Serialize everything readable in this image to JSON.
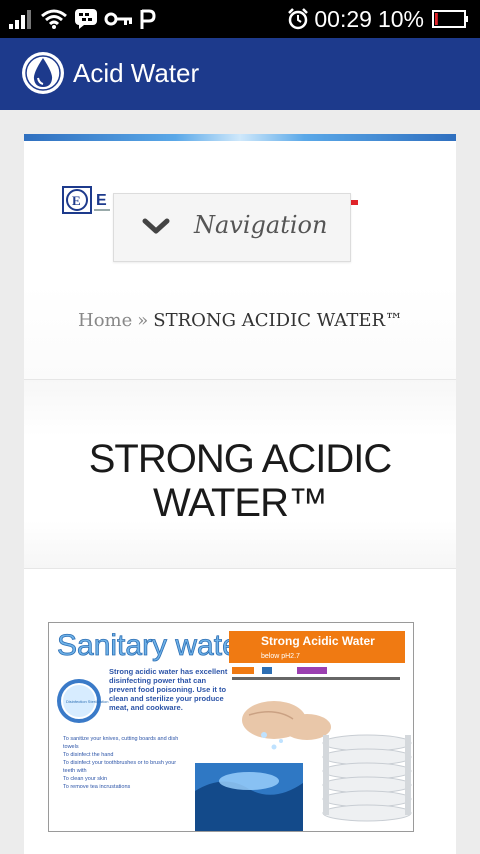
{
  "status_bar": {
    "time": "00:29",
    "battery_percent": "10%",
    "battery_level": 0.1,
    "icons": [
      "signal-icon",
      "wifi-icon",
      "bbm-icon",
      "key-icon",
      "p-icon",
      "alarm-icon",
      "battery-icon"
    ]
  },
  "app_bar": {
    "title": "Acid Water",
    "logo_icon": "water-drop-icon",
    "color": "#1d3a8c"
  },
  "navigation": {
    "label": "Navigation",
    "icon": "chevron-down-icon"
  },
  "breadcrumb": {
    "home": "Home",
    "separator": "»",
    "current": "STRONG ACIDIC WATER™"
  },
  "page": {
    "title_line1": "STRONG ACIDIC",
    "title_line2": "WATER™"
  },
  "poster": {
    "heading": "Sanitary water",
    "banner": "Strong Acidic Water",
    "banner_sub": "below pH2.7",
    "intro": "Strong acidic water has excellent disinfecting power that can prevent food poisoning. Use it to clean and sterilize your produce meat, and cookware.",
    "bullets": [
      "To sanitize your knives, cutting boards and dish towels",
      "To disinfect the hand",
      "To disinfect your toothbrushes or to brush your teeth with",
      "To clean your skin",
      "To remove tea incrustations"
    ],
    "badge": "Disinfection Sterilization"
  },
  "colors": {
    "app_bar": "#1d3a8c",
    "background": "#ececec",
    "poster_orange": "#f07a12",
    "brand_red": "#e0242a"
  }
}
